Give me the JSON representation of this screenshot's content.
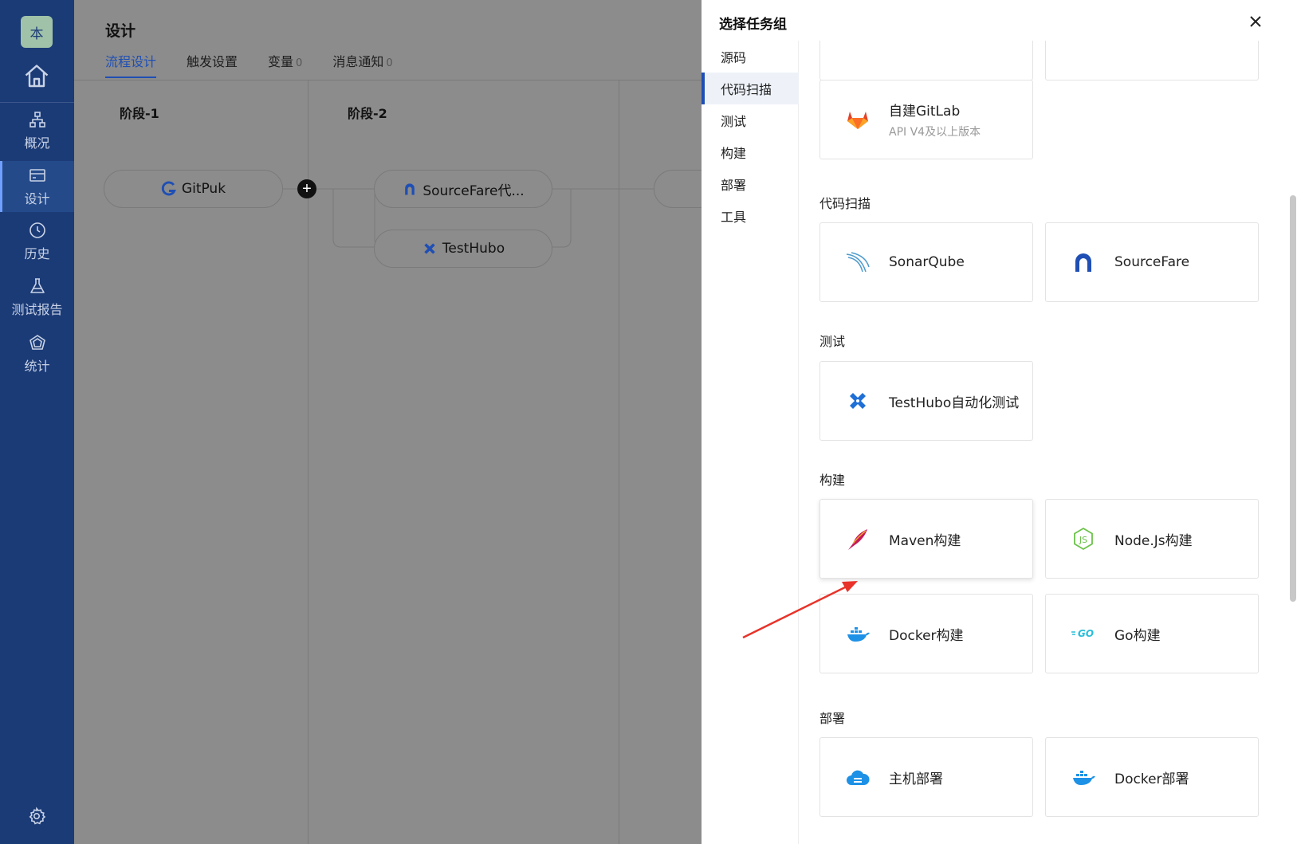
{
  "sidebar": {
    "logo_text": "本",
    "items": [
      {
        "label": "概况",
        "icon": "sitemap-icon"
      },
      {
        "label": "设计",
        "icon": "design-icon"
      },
      {
        "label": "历史",
        "icon": "clock-icon"
      },
      {
        "label": "测试报告",
        "icon": "flask-icon"
      },
      {
        "label": "统计",
        "icon": "chart-icon"
      }
    ]
  },
  "header": {
    "title": "设计",
    "tabs": [
      {
        "label": "流程设计",
        "count": ""
      },
      {
        "label": "触发设置",
        "count": ""
      },
      {
        "label": "变量",
        "count": "0"
      },
      {
        "label": "消息通知",
        "count": "0"
      }
    ]
  },
  "pipeline": {
    "stages": [
      {
        "title": "阶段-1",
        "tasks": [
          "GitPuk"
        ]
      },
      {
        "title": "阶段-2",
        "tasks": [
          "SourceFare代...",
          "TestHubo"
        ]
      }
    ],
    "add_symbol": "+"
  },
  "panel": {
    "title": "选择任务组",
    "categories": [
      "源码",
      "代码扫描",
      "测试",
      "构建",
      "部署",
      "工具"
    ],
    "active_category": "代码扫描",
    "source": {
      "gitlab_name": "自建GitLab",
      "gitlab_desc": "API V4及以上版本"
    },
    "scan": {
      "title": "代码扫描",
      "items": [
        "SonarQube",
        "SourceFare"
      ]
    },
    "test": {
      "title": "测试",
      "items": [
        "TestHubo自动化测试"
      ]
    },
    "build": {
      "title": "构建",
      "items": [
        "Maven构建",
        "Node.Js构建",
        "Docker构建",
        "Go构建"
      ]
    },
    "deploy": {
      "title": "部署",
      "items": [
        "主机部署",
        "Docker部署"
      ]
    }
  },
  "colors": {
    "sidebar_bg": "#1b3b77",
    "accent": "#1f4fb4",
    "annotation_arrow": "#e8332a"
  }
}
